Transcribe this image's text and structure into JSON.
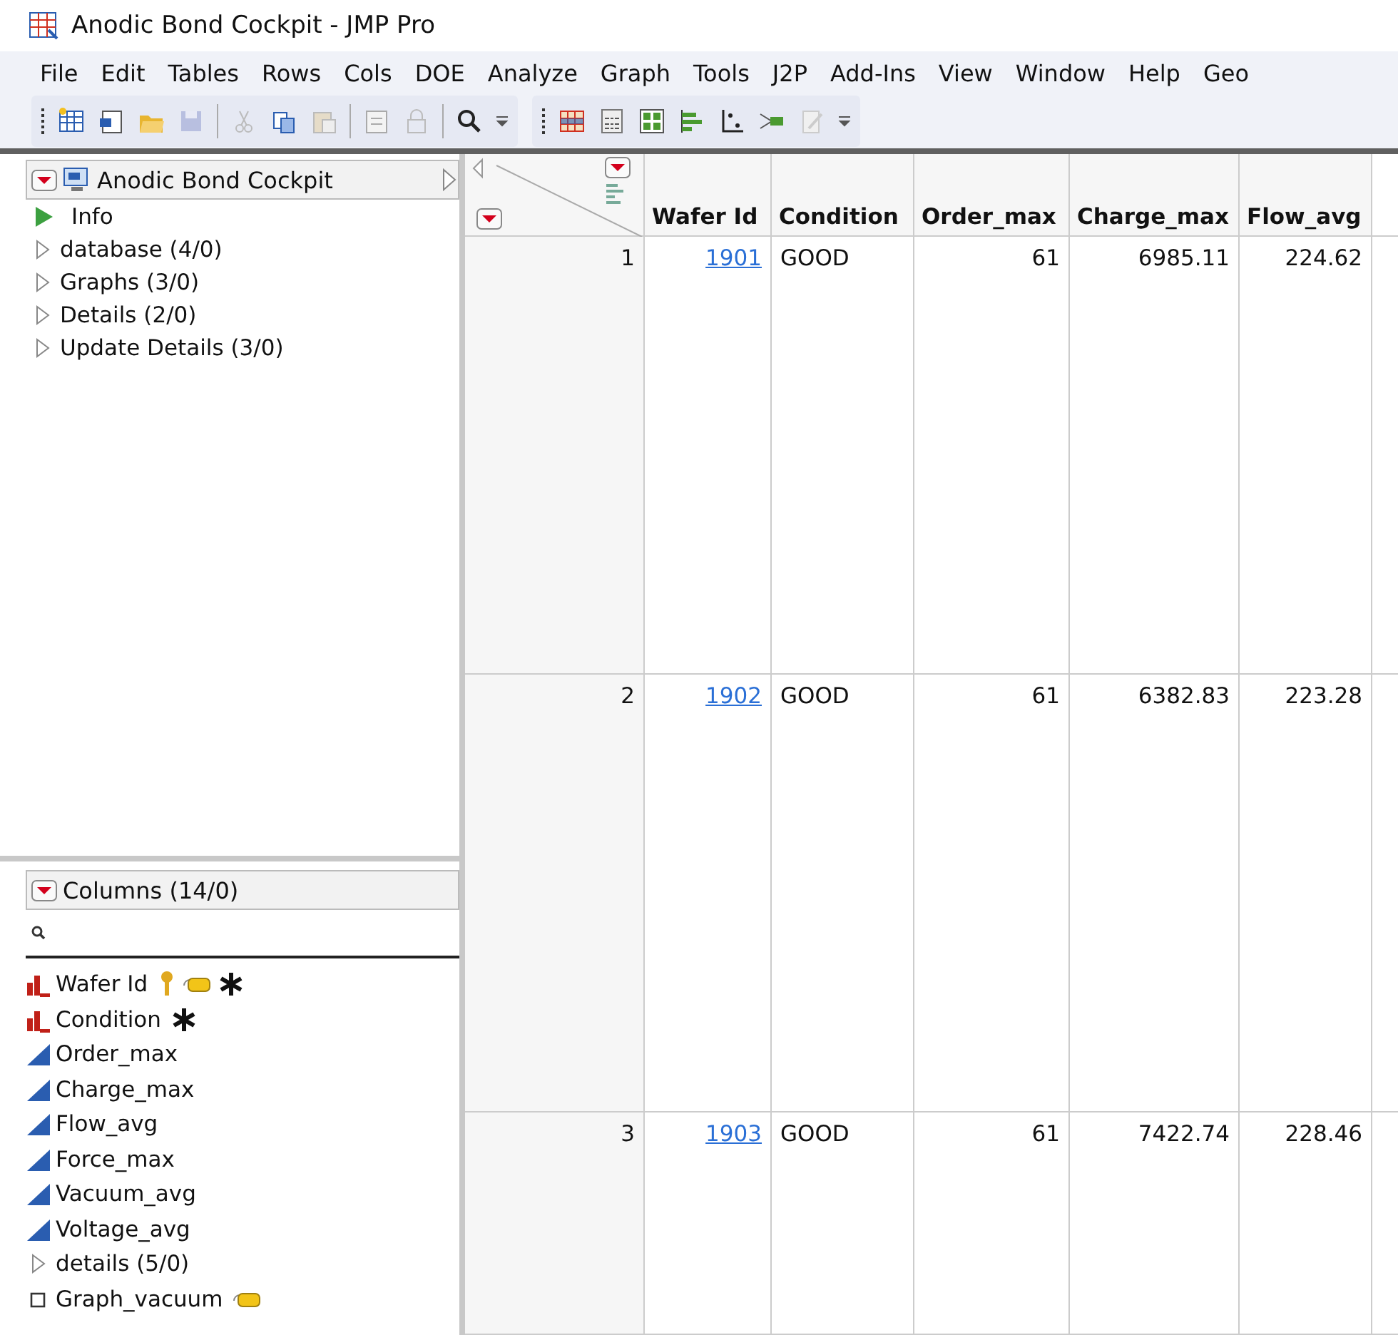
{
  "window": {
    "title": "Anodic Bond Cockpit - JMP Pro"
  },
  "menu": [
    "File",
    "Edit",
    "Tables",
    "Rows",
    "Cols",
    "DOE",
    "Analyze",
    "Graph",
    "Tools",
    "J2P",
    "Add-Ins",
    "View",
    "Window",
    "Help",
    "Geo"
  ],
  "tables_panel": {
    "title": "Anodic Bond Cockpit",
    "items": [
      {
        "label": "Info",
        "kind": "script"
      },
      {
        "label": "database (4/0)",
        "kind": "group"
      },
      {
        "label": "Graphs (3/0)",
        "kind": "group"
      },
      {
        "label": "Details (2/0)",
        "kind": "group"
      },
      {
        "label": "Update Details (3/0)",
        "kind": "group"
      }
    ]
  },
  "columns_panel": {
    "title": "Columns (14/0)",
    "items": [
      {
        "label": "Wafer Id",
        "kind": "nominal",
        "key": true,
        "note": true,
        "formula": true
      },
      {
        "label": "Condition",
        "kind": "nominal",
        "key": false,
        "note": false,
        "formula": true
      },
      {
        "label": "Order_max",
        "kind": "continuous",
        "key": false,
        "note": false,
        "formula": false
      },
      {
        "label": "Charge_max",
        "kind": "continuous",
        "key": false,
        "note": false,
        "formula": false
      },
      {
        "label": "Flow_avg",
        "kind": "continuous",
        "key": false,
        "note": false,
        "formula": false
      },
      {
        "label": "Force_max",
        "kind": "continuous",
        "key": false,
        "note": false,
        "formula": false
      },
      {
        "label": "Vacuum_avg",
        "kind": "continuous",
        "key": false,
        "note": false,
        "formula": false
      },
      {
        "label": "Voltage_avg",
        "kind": "continuous",
        "key": false,
        "note": false,
        "formula": false
      },
      {
        "label": "details (5/0)",
        "kind": "group",
        "key": false,
        "note": false,
        "formula": false
      },
      {
        "label": "Graph_vacuum",
        "kind": "expression",
        "key": false,
        "note": true,
        "formula": false
      }
    ]
  },
  "table": {
    "columns": [
      {
        "label": "Wafer Id",
        "kind": "link"
      },
      {
        "label": "Condition",
        "kind": "text"
      },
      {
        "label": "Order_max",
        "kind": "number"
      },
      {
        "label": "Charge_max",
        "kind": "number"
      },
      {
        "label": "Flow_avg",
        "kind": "number"
      }
    ],
    "rows": [
      {
        "number": "1",
        "cells": [
          "1901",
          "GOOD",
          "61",
          "6985.11",
          "224.62"
        ]
      },
      {
        "number": "2",
        "cells": [
          "1902",
          "GOOD",
          "61",
          "6382.83",
          "223.28"
        ]
      },
      {
        "number": "3",
        "cells": [
          "1903",
          "GOOD",
          "61",
          "7422.74",
          "228.46"
        ]
      }
    ]
  }
}
